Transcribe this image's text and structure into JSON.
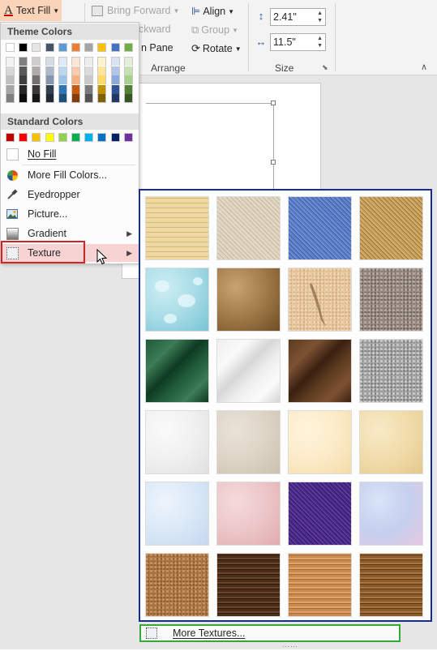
{
  "ribbon": {
    "text_fill_label": "Text Fill",
    "bring_forward_label": "Bring Forward",
    "send_backward_label": "ckward",
    "selection_pane_label": "n Pane",
    "align_label": "Align",
    "group_label": "Group",
    "rotate_label": "Rotate",
    "arrange_group_label": "Arrange",
    "size_group_label": "Size",
    "height_value": "2.41\"",
    "width_value": "11.5\""
  },
  "menu": {
    "theme_colors_header": "Theme Colors",
    "standard_colors_header": "Standard Colors",
    "theme_columns": [
      [
        "#ffffff",
        "#f2f2f2",
        "#d8d8d8",
        "#bfbfbf",
        "#a5a5a5",
        "#7f7f7f"
      ],
      [
        "#000000",
        "#7f7f7f",
        "#595959",
        "#3f3f3f",
        "#262626",
        "#0c0c0c"
      ],
      [
        "#e7e6e6",
        "#d0cece",
        "#aeabab",
        "#757070",
        "#3a3838",
        "#171616"
      ],
      [
        "#44546a",
        "#d6dce4",
        "#adb9ca",
        "#8496b0",
        "#333f4f",
        "#222a35"
      ],
      [
        "#5b9bd5",
        "#deebf6",
        "#bdd7ee",
        "#9dc3e6",
        "#2e75b5",
        "#1f4e79"
      ],
      [
        "#ed7d31",
        "#fbe5d5",
        "#f7cbac",
        "#f4b183",
        "#c55a11",
        "#833c0b"
      ],
      [
        "#a5a5a5",
        "#ededed",
        "#dbdbdb",
        "#c9c9c9",
        "#7b7b7b",
        "#525252"
      ],
      [
        "#ffc000",
        "#fff2cc",
        "#fee599",
        "#ffd965",
        "#bf9000",
        "#7f6000"
      ],
      [
        "#4472c4",
        "#dae3f3",
        "#b4c6e7",
        "#8eaadb",
        "#2f5496",
        "#1f3864"
      ],
      [
        "#70ad47",
        "#e2efd9",
        "#c5e0b3",
        "#a8d08d",
        "#538135",
        "#375623"
      ]
    ],
    "standard_colors": [
      "#c00000",
      "#ff0000",
      "#ffc000",
      "#ffff00",
      "#92d050",
      "#00b050",
      "#00b0f0",
      "#0070c0",
      "#002060",
      "#7030a0"
    ],
    "no_fill_label": "No Fill",
    "more_fill_colors_label": "More Fill Colors...",
    "eyedropper_label": "Eyedropper",
    "picture_label": "Picture...",
    "gradient_label": "Gradient",
    "texture_label": "Texture"
  },
  "textures": [
    {
      "name": "papyrus",
      "colors": [
        "#f0d9a0",
        "#d9b872",
        "#ecd8a6"
      ]
    },
    {
      "name": "canvas",
      "colors": [
        "#ddd2bd",
        "#c7b9a0",
        "#e9e1d0"
      ]
    },
    {
      "name": "denim",
      "colors": [
        "#5a7fc8",
        "#3c5fa8",
        "#7e9ad8"
      ]
    },
    {
      "name": "woven-mat",
      "colors": [
        "#c8a060",
        "#9c7438",
        "#dcb876"
      ]
    },
    {
      "name": "water-droplets",
      "colors": [
        "#a8dce6",
        "#78c4d4",
        "#cdeef2"
      ]
    },
    {
      "name": "paper-bag",
      "colors": [
        "#a07a48",
        "#6e4e26",
        "#c8a472"
      ]
    },
    {
      "name": "fish-fossil",
      "colors": [
        "#e8c9a0",
        "#d4ad80",
        "#efd8b8"
      ]
    },
    {
      "name": "sand",
      "colors": [
        "#9a8e86",
        "#6e625c",
        "#bcb0a6"
      ]
    },
    {
      "name": "green-marble",
      "colors": [
        "#1e5a38",
        "#0e3a22",
        "#3c7c56"
      ]
    },
    {
      "name": "white-marble",
      "colors": [
        "#eeeeee",
        "#d6d6d6",
        "#fafafa"
      ]
    },
    {
      "name": "brown-marble",
      "colors": [
        "#5c3a20",
        "#3a2010",
        "#7c5232"
      ]
    },
    {
      "name": "granite",
      "colors": [
        "#a8a8a8",
        "#7c7c7c",
        "#d0d0d0"
      ]
    },
    {
      "name": "newsprint",
      "colors": [
        "#f0f0f0",
        "#e0e0e0",
        "#fafafa"
      ]
    },
    {
      "name": "recycled-paper",
      "colors": [
        "#ddd4c6",
        "#cbc0ae",
        "#e9e2d6"
      ]
    },
    {
      "name": "parchment",
      "colors": [
        "#fbebc8",
        "#f4dca8",
        "#fff4dc"
      ]
    },
    {
      "name": "stationery",
      "colors": [
        "#f0dcaa",
        "#e4c88c",
        "#f8eac8"
      ]
    },
    {
      "name": "blue-tissue-paper",
      "colors": [
        "#dae8f6",
        "#c4d8ee",
        "#eef4fc"
      ]
    },
    {
      "name": "pink-tissue-paper",
      "colors": [
        "#ecc6c8",
        "#e0acb0",
        "#f4dadc"
      ]
    },
    {
      "name": "purple-mesh",
      "colors": [
        "#4a2a88",
        "#321a66",
        "#6a46a8"
      ]
    },
    {
      "name": "bouquet",
      "colors": [
        "#c4d0ee",
        "#e4c8e0",
        "#d8e4f6"
      ]
    },
    {
      "name": "cork",
      "colors": [
        "#b07a48",
        "#8c5a30",
        "#cc9862"
      ]
    },
    {
      "name": "walnut",
      "colors": [
        "#4a2e1a",
        "#2e1a0c",
        "#6a442a"
      ]
    },
    {
      "name": "oak",
      "colors": [
        "#c88a4e",
        "#a66a34",
        "#e0a46a"
      ]
    },
    {
      "name": "medium-wood",
      "colors": [
        "#8a5a2a",
        "#5e3a14",
        "#a87440"
      ]
    }
  ],
  "more_textures_label": "More Textures..."
}
